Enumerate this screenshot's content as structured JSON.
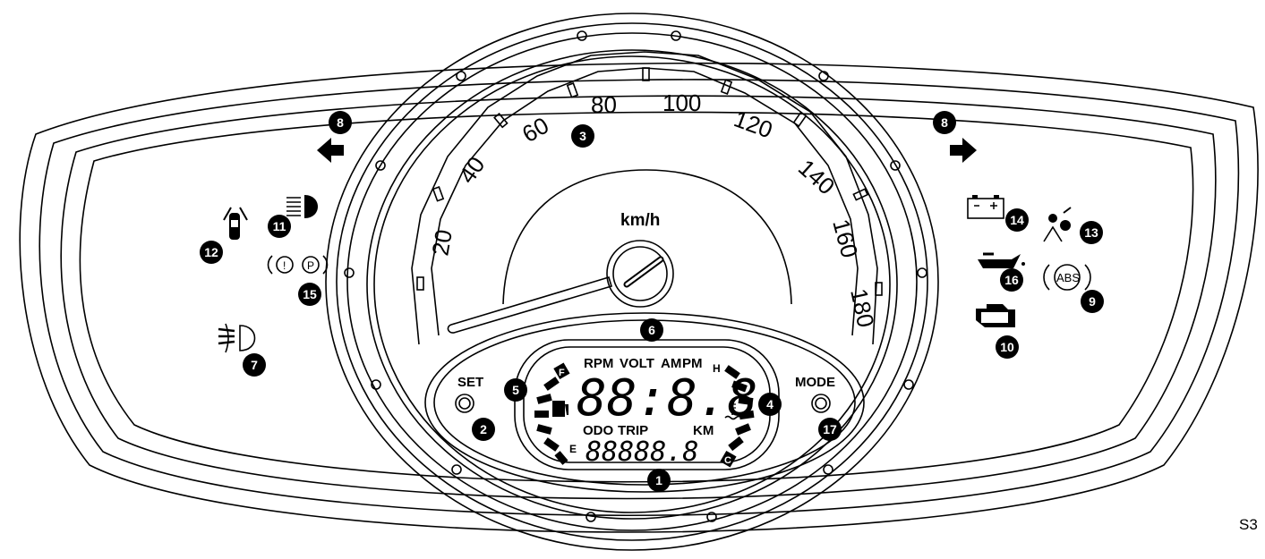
{
  "speedometer": {
    "unit_label": "km/h",
    "scale_labels": [
      "20",
      "40",
      "60",
      "80",
      "100",
      "120",
      "140",
      "160",
      "180"
    ]
  },
  "lcd": {
    "top_labels": [
      "RPM",
      "VOLT",
      "AM",
      "PM"
    ],
    "bottom_labels": [
      "ODO",
      "TRIP",
      "KM"
    ],
    "main_digits": "88:8.8",
    "odo_digits": "88888.8",
    "fuel_full": "F",
    "fuel_empty": "E",
    "temp_hot": "H",
    "temp_cold": "C"
  },
  "buttons": {
    "set_label": "SET",
    "mode_label": "MODE"
  },
  "callouts": {
    "lcd_display": "1",
    "set_button": "2",
    "speedometer": "3",
    "temp_gauge": "4",
    "fuel_gauge": "5",
    "info_display": "6",
    "fog_lamp": "7",
    "turn_left": "8",
    "turn_right": "8",
    "abs": "9",
    "check_engine": "10",
    "high_beam": "11",
    "door_open": "12",
    "airbag": "13",
    "battery": "14",
    "brake_parking": "15",
    "oil_pressure": "16",
    "mode_button": "17"
  },
  "indicators": {
    "abs_text": "ABS",
    "parking_text": "P",
    "brake_text": "!"
  },
  "figure_code": "S3"
}
